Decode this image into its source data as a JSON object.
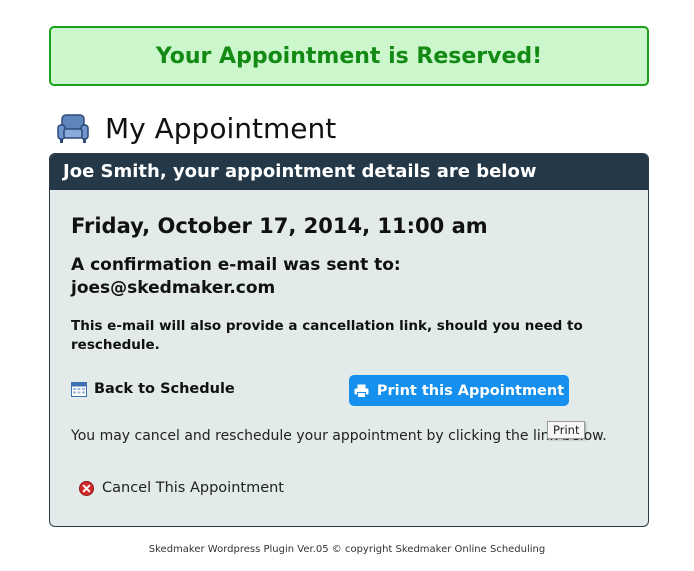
{
  "banner": {
    "text": "Your Appointment is Reserved!"
  },
  "page": {
    "title": "My Appointment",
    "icon": "armchair-icon"
  },
  "panel": {
    "header": "Joe Smith, your appointment details are below",
    "datetime": "Friday, October 17, 2014, 11:00 am",
    "confirmation_line": "A confirmation e-mail was sent to:",
    "email": "joes@skedmaker.com",
    "note": "This e-mail will also provide a cancellation link, should you need to reschedule.",
    "back_link": {
      "label": "Back to Schedule",
      "icon": "calendar-icon"
    },
    "print_button": {
      "label": "Print this Appointment",
      "icon": "printer-icon"
    },
    "instructions": "You may cancel and reschedule your appointment by clicking the link below.",
    "tooltip": "Print",
    "cancel_link": {
      "label": "Cancel This Appointment",
      "icon": "cancel-x-icon"
    }
  },
  "footer": {
    "text": "Skedmaker Wordpress Plugin Ver.05 © copyright Skedmaker Online Scheduling"
  },
  "colors": {
    "banner_bg": "#ccf7cc",
    "banner_text": "#138a13",
    "panel_header_bg": "#243847",
    "panel_bg": "#e2eaea",
    "print_button_bg": "#1690ee"
  }
}
